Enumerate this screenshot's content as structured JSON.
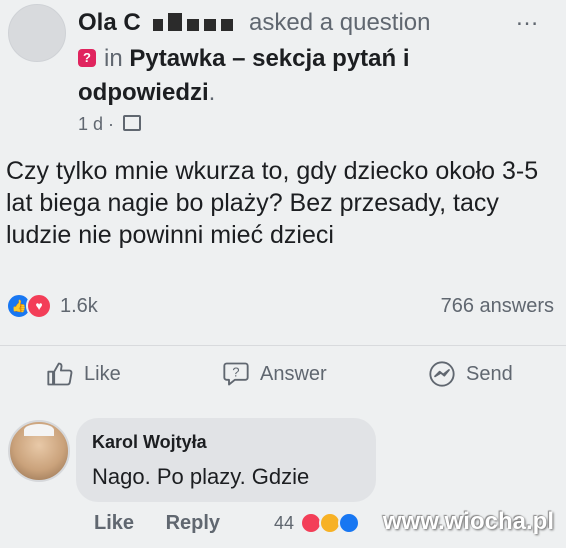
{
  "post": {
    "author_name": "Ola C",
    "action_text": "asked a question",
    "more_icon": "…",
    "group_prefix": "in",
    "group_name": "Pytawka – sekcja pytań i",
    "group_name_cont": "odpowiedzi",
    "group_suffix": ".",
    "time": "1 d ·",
    "body": "Czy tylko mnie wkurza to, gdy  dziecko około 3-5 lat biega nagie bo plaży? Bez przesady, tacy ludzie nie powinni mieć dzieci",
    "reaction_count": "1.6k",
    "answers": "766 answers"
  },
  "actions": {
    "like": "Like",
    "answer": "Answer",
    "send": "Send"
  },
  "comment": {
    "author": "Karol Wojtyła",
    "text": "Nago. Po plazy. Gdzie",
    "like": "Like",
    "reply": "Reply",
    "reaction_count": "44"
  },
  "watermark": "www.wiocha.pl",
  "colors": {
    "like_blue": "#1877f2",
    "love_red": "#f33e58",
    "haha_yellow": "#f7b125",
    "question_badge": "#e0245e"
  }
}
